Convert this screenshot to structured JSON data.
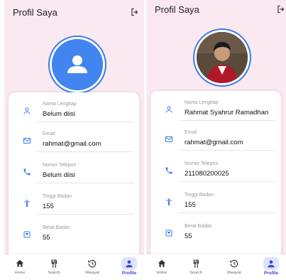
{
  "screens": [
    {
      "title": "Profil Saya",
      "fields": [
        {
          "label": "Nama Lengkap",
          "value": "Belum diisi"
        },
        {
          "label": "Email",
          "value": "rahmat@gmail.com"
        },
        {
          "label": "Nomor Telepon",
          "value": "Belum diisi"
        },
        {
          "label": "Tinggi Badan",
          "value": "155"
        },
        {
          "label": "Berat Badan",
          "value": "55"
        }
      ],
      "nav": [
        {
          "label": "Home"
        },
        {
          "label": "Search"
        },
        {
          "label": "Riwayat"
        },
        {
          "label": "Profile"
        }
      ]
    },
    {
      "title": "Profil Saya",
      "fields": [
        {
          "label": "Nama Lengkap",
          "value": "Rahmat Syahrur Ramadhan"
        },
        {
          "label": "Email",
          "value": "rahmat@gmail.com"
        },
        {
          "label": "Nomor Telepon",
          "value": "211080200025"
        },
        {
          "label": "Tinggi Badan",
          "value": "155"
        },
        {
          "label": "Berat Badan",
          "value": "55"
        }
      ],
      "nav": [
        {
          "label": "Home"
        },
        {
          "label": "Search"
        },
        {
          "label": "Riwayat"
        },
        {
          "label": "Profile"
        }
      ]
    }
  ],
  "colors": {
    "background": "#fbe9f2",
    "accent": "#4285f0",
    "icon": "#3b7be8",
    "nav_active_bg": "#dfe3ff",
    "nav_active_text": "#3b47c9"
  },
  "icons": {
    "logout": "logout-icon",
    "avatar_placeholder": "person-icon",
    "fields": [
      "person-icon",
      "mail-icon",
      "phone-icon",
      "accessibility-icon",
      "scale-icon"
    ],
    "nav": [
      "home-icon",
      "fork-knife-icon",
      "history-icon",
      "person-icon"
    ]
  },
  "active_nav": "Profile"
}
